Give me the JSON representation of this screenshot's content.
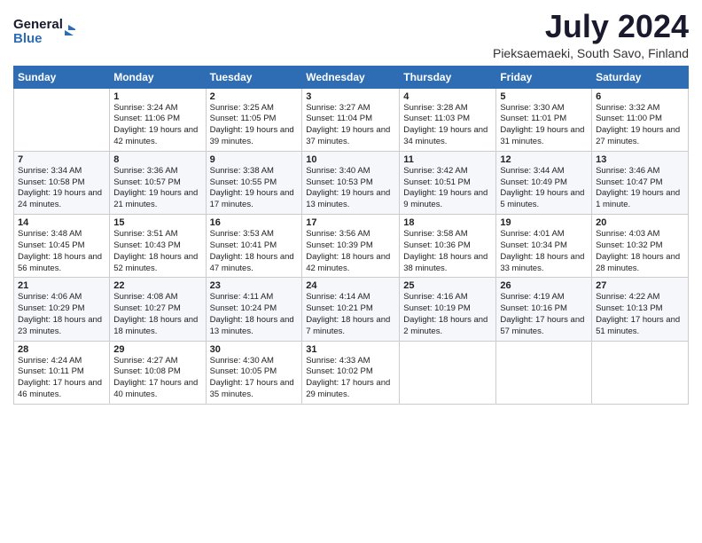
{
  "header": {
    "logo_line1": "General",
    "logo_line2": "Blue",
    "title": "July 2024",
    "location": "Pieksaemaeki, South Savo, Finland"
  },
  "weekdays": [
    "Sunday",
    "Monday",
    "Tuesday",
    "Wednesday",
    "Thursday",
    "Friday",
    "Saturday"
  ],
  "weeks": [
    [
      {
        "day": "",
        "sunrise": "",
        "sunset": "",
        "daylight": ""
      },
      {
        "day": "1",
        "sunrise": "Sunrise: 3:24 AM",
        "sunset": "Sunset: 11:06 PM",
        "daylight": "Daylight: 19 hours and 42 minutes."
      },
      {
        "day": "2",
        "sunrise": "Sunrise: 3:25 AM",
        "sunset": "Sunset: 11:05 PM",
        "daylight": "Daylight: 19 hours and 39 minutes."
      },
      {
        "day": "3",
        "sunrise": "Sunrise: 3:27 AM",
        "sunset": "Sunset: 11:04 PM",
        "daylight": "Daylight: 19 hours and 37 minutes."
      },
      {
        "day": "4",
        "sunrise": "Sunrise: 3:28 AM",
        "sunset": "Sunset: 11:03 PM",
        "daylight": "Daylight: 19 hours and 34 minutes."
      },
      {
        "day": "5",
        "sunrise": "Sunrise: 3:30 AM",
        "sunset": "Sunset: 11:01 PM",
        "daylight": "Daylight: 19 hours and 31 minutes."
      },
      {
        "day": "6",
        "sunrise": "Sunrise: 3:32 AM",
        "sunset": "Sunset: 11:00 PM",
        "daylight": "Daylight: 19 hours and 27 minutes."
      }
    ],
    [
      {
        "day": "7",
        "sunrise": "Sunrise: 3:34 AM",
        "sunset": "Sunset: 10:58 PM",
        "daylight": "Daylight: 19 hours and 24 minutes."
      },
      {
        "day": "8",
        "sunrise": "Sunrise: 3:36 AM",
        "sunset": "Sunset: 10:57 PM",
        "daylight": "Daylight: 19 hours and 21 minutes."
      },
      {
        "day": "9",
        "sunrise": "Sunrise: 3:38 AM",
        "sunset": "Sunset: 10:55 PM",
        "daylight": "Daylight: 19 hours and 17 minutes."
      },
      {
        "day": "10",
        "sunrise": "Sunrise: 3:40 AM",
        "sunset": "Sunset: 10:53 PM",
        "daylight": "Daylight: 19 hours and 13 minutes."
      },
      {
        "day": "11",
        "sunrise": "Sunrise: 3:42 AM",
        "sunset": "Sunset: 10:51 PM",
        "daylight": "Daylight: 19 hours and 9 minutes."
      },
      {
        "day": "12",
        "sunrise": "Sunrise: 3:44 AM",
        "sunset": "Sunset: 10:49 PM",
        "daylight": "Daylight: 19 hours and 5 minutes."
      },
      {
        "day": "13",
        "sunrise": "Sunrise: 3:46 AM",
        "sunset": "Sunset: 10:47 PM",
        "daylight": "Daylight: 19 hours and 1 minute."
      }
    ],
    [
      {
        "day": "14",
        "sunrise": "Sunrise: 3:48 AM",
        "sunset": "Sunset: 10:45 PM",
        "daylight": "Daylight: 18 hours and 56 minutes."
      },
      {
        "day": "15",
        "sunrise": "Sunrise: 3:51 AM",
        "sunset": "Sunset: 10:43 PM",
        "daylight": "Daylight: 18 hours and 52 minutes."
      },
      {
        "day": "16",
        "sunrise": "Sunrise: 3:53 AM",
        "sunset": "Sunset: 10:41 PM",
        "daylight": "Daylight: 18 hours and 47 minutes."
      },
      {
        "day": "17",
        "sunrise": "Sunrise: 3:56 AM",
        "sunset": "Sunset: 10:39 PM",
        "daylight": "Daylight: 18 hours and 42 minutes."
      },
      {
        "day": "18",
        "sunrise": "Sunrise: 3:58 AM",
        "sunset": "Sunset: 10:36 PM",
        "daylight": "Daylight: 18 hours and 38 minutes."
      },
      {
        "day": "19",
        "sunrise": "Sunrise: 4:01 AM",
        "sunset": "Sunset: 10:34 PM",
        "daylight": "Daylight: 18 hours and 33 minutes."
      },
      {
        "day": "20",
        "sunrise": "Sunrise: 4:03 AM",
        "sunset": "Sunset: 10:32 PM",
        "daylight": "Daylight: 18 hours and 28 minutes."
      }
    ],
    [
      {
        "day": "21",
        "sunrise": "Sunrise: 4:06 AM",
        "sunset": "Sunset: 10:29 PM",
        "daylight": "Daylight: 18 hours and 23 minutes."
      },
      {
        "day": "22",
        "sunrise": "Sunrise: 4:08 AM",
        "sunset": "Sunset: 10:27 PM",
        "daylight": "Daylight: 18 hours and 18 minutes."
      },
      {
        "day": "23",
        "sunrise": "Sunrise: 4:11 AM",
        "sunset": "Sunset: 10:24 PM",
        "daylight": "Daylight: 18 hours and 13 minutes."
      },
      {
        "day": "24",
        "sunrise": "Sunrise: 4:14 AM",
        "sunset": "Sunset: 10:21 PM",
        "daylight": "Daylight: 18 hours and 7 minutes."
      },
      {
        "day": "25",
        "sunrise": "Sunrise: 4:16 AM",
        "sunset": "Sunset: 10:19 PM",
        "daylight": "Daylight: 18 hours and 2 minutes."
      },
      {
        "day": "26",
        "sunrise": "Sunrise: 4:19 AM",
        "sunset": "Sunset: 10:16 PM",
        "daylight": "Daylight: 17 hours and 57 minutes."
      },
      {
        "day": "27",
        "sunrise": "Sunrise: 4:22 AM",
        "sunset": "Sunset: 10:13 PM",
        "daylight": "Daylight: 17 hours and 51 minutes."
      }
    ],
    [
      {
        "day": "28",
        "sunrise": "Sunrise: 4:24 AM",
        "sunset": "Sunset: 10:11 PM",
        "daylight": "Daylight: 17 hours and 46 minutes."
      },
      {
        "day": "29",
        "sunrise": "Sunrise: 4:27 AM",
        "sunset": "Sunset: 10:08 PM",
        "daylight": "Daylight: 17 hours and 40 minutes."
      },
      {
        "day": "30",
        "sunrise": "Sunrise: 4:30 AM",
        "sunset": "Sunset: 10:05 PM",
        "daylight": "Daylight: 17 hours and 35 minutes."
      },
      {
        "day": "31",
        "sunrise": "Sunrise: 4:33 AM",
        "sunset": "Sunset: 10:02 PM",
        "daylight": "Daylight: 17 hours and 29 minutes."
      },
      {
        "day": "",
        "sunrise": "",
        "sunset": "",
        "daylight": ""
      },
      {
        "day": "",
        "sunrise": "",
        "sunset": "",
        "daylight": ""
      },
      {
        "day": "",
        "sunrise": "",
        "sunset": "",
        "daylight": ""
      }
    ]
  ]
}
